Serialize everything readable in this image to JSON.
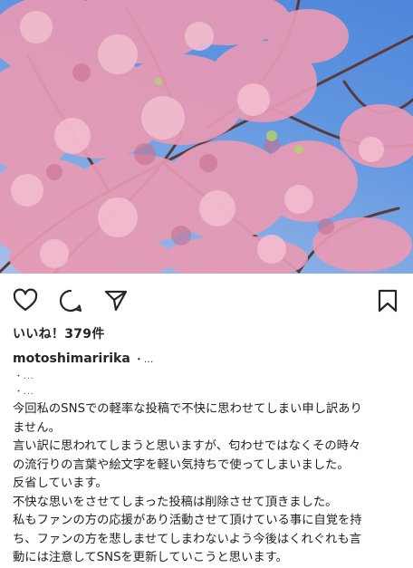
{
  "post": {
    "likes_text": "いいね！379件",
    "username": "motoshimaririka",
    "username_tail": "・...",
    "markers": [
      "・...",
      "・..."
    ],
    "caption_lines": [
      "今回私のSNSでの軽率な投稿で不快に思わせてしまい申し訳あり",
      "ません。",
      "言い訳に思われてしまうと思いますが、匂わせではなくその時々",
      "の流行りの言葉や絵文字を軽い気持ちで使ってしまいました。",
      "反省しています。",
      "不快な思いをさせてしまった投稿は削除させて頂きました。",
      "私もファンの方の応援があり活動させて頂けている事に自覚を持",
      "ち、ファンの方を悲しませてしまわないよう今後はくれぐれも言",
      "動には注意してSNSを更新していこうと思います。"
    ]
  },
  "icons": {
    "like": "heart-icon",
    "comment": "comment-bubble-icon",
    "share": "paper-plane-icon",
    "save": "bookmark-icon"
  },
  "colors": {
    "sky": "#5f95e0",
    "blossom": "#e89ab4",
    "text": "#262626"
  }
}
